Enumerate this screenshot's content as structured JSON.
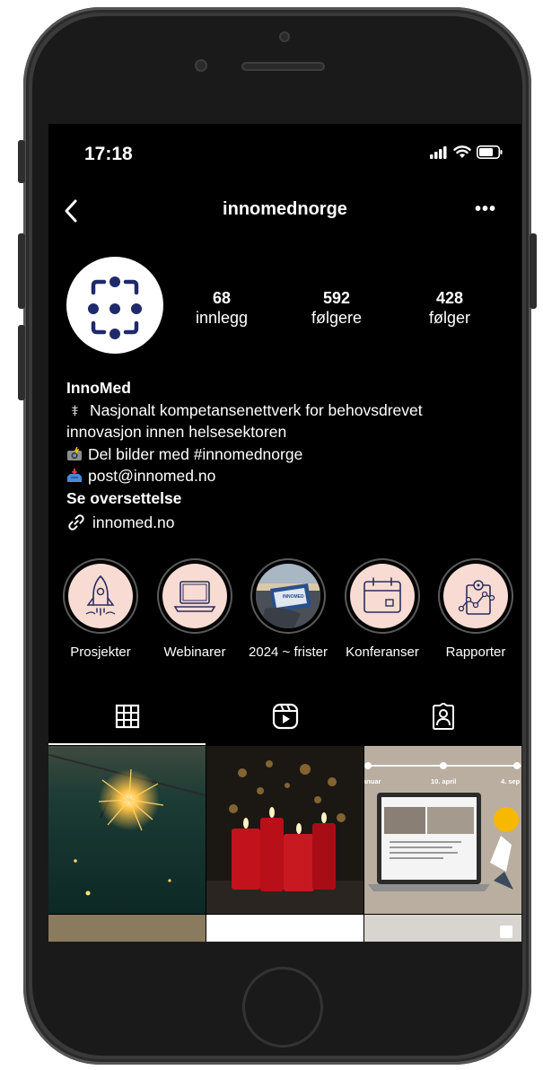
{
  "status": {
    "time": "17:18"
  },
  "header": {
    "username": "innomednorge"
  },
  "profile": {
    "stats": [
      {
        "value": "68",
        "label": "innlegg"
      },
      {
        "value": "592",
        "label": "følgere"
      },
      {
        "value": "428",
        "label": "følger"
      }
    ],
    "name": "InnoMed",
    "bio_line1": "Nasjonalt kompetansenettverk for behovsdrevet",
    "bio_line2": "innovasjon innen helsesektoren",
    "bio_photo": "Del bilder med #innomednorge",
    "bio_email": "post@innomed.no",
    "translate": "Se oversettelse",
    "link": "innomed.no"
  },
  "highlights": [
    {
      "label": "Prosjekter",
      "icon": "rocket-icon"
    },
    {
      "label": "Webinarer",
      "icon": "laptop-icon"
    },
    {
      "label": "2024 ~ frister",
      "icon": "photo"
    },
    {
      "label": "Konferanser",
      "icon": "calendar-icon"
    },
    {
      "label": "Rapporter",
      "icon": "report-icon"
    }
  ],
  "grid_overlay": {
    "left": "anuar",
    "mid": "10. april",
    "right": "4. sep"
  },
  "colors": {
    "accent_navy": "#1f2a6b",
    "highlight_bg": "#f8dcd3"
  }
}
